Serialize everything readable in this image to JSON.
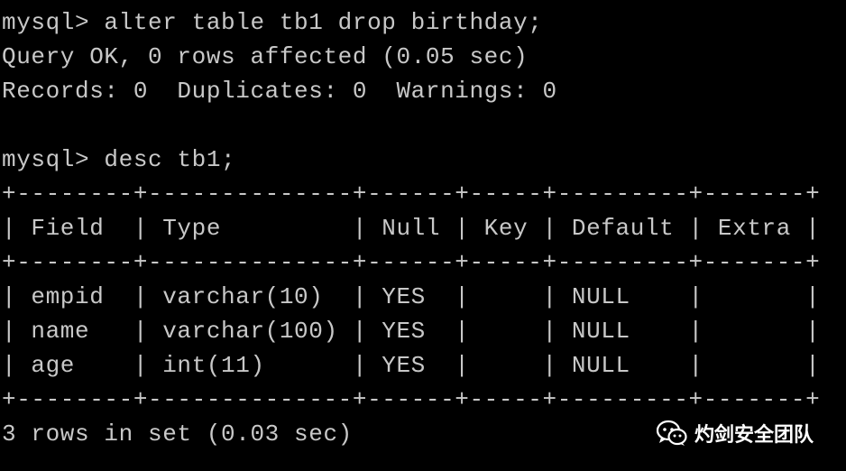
{
  "terminal": {
    "lines": [
      "mysql> alter table tb1 drop birthday;",
      "Query OK, 0 rows affected (0.05 sec)",
      "Records: 0  Duplicates: 0  Warnings: 0",
      "",
      "mysql> desc tb1;",
      "+--------+--------------+------+-----+---------+-------+",
      "| Field  | Type         | Null | Key | Default | Extra |",
      "+--------+--------------+------+-----+---------+-------+",
      "| empid  | varchar(10)  | YES  |     | NULL    |       |",
      "| name   | varchar(100) | YES  |     | NULL    |       |",
      "| age    | int(11)      | YES  |     | NULL    |       |",
      "+--------+--------------+------+-----+---------+-------+",
      "3 rows in set (0.03 sec)"
    ]
  },
  "watermark": {
    "text": "灼剑安全团队",
    "icon": "wechat-icon"
  },
  "colors": {
    "background": "#000000",
    "text": "#c8c8c8",
    "watermark": "#ffffff"
  }
}
